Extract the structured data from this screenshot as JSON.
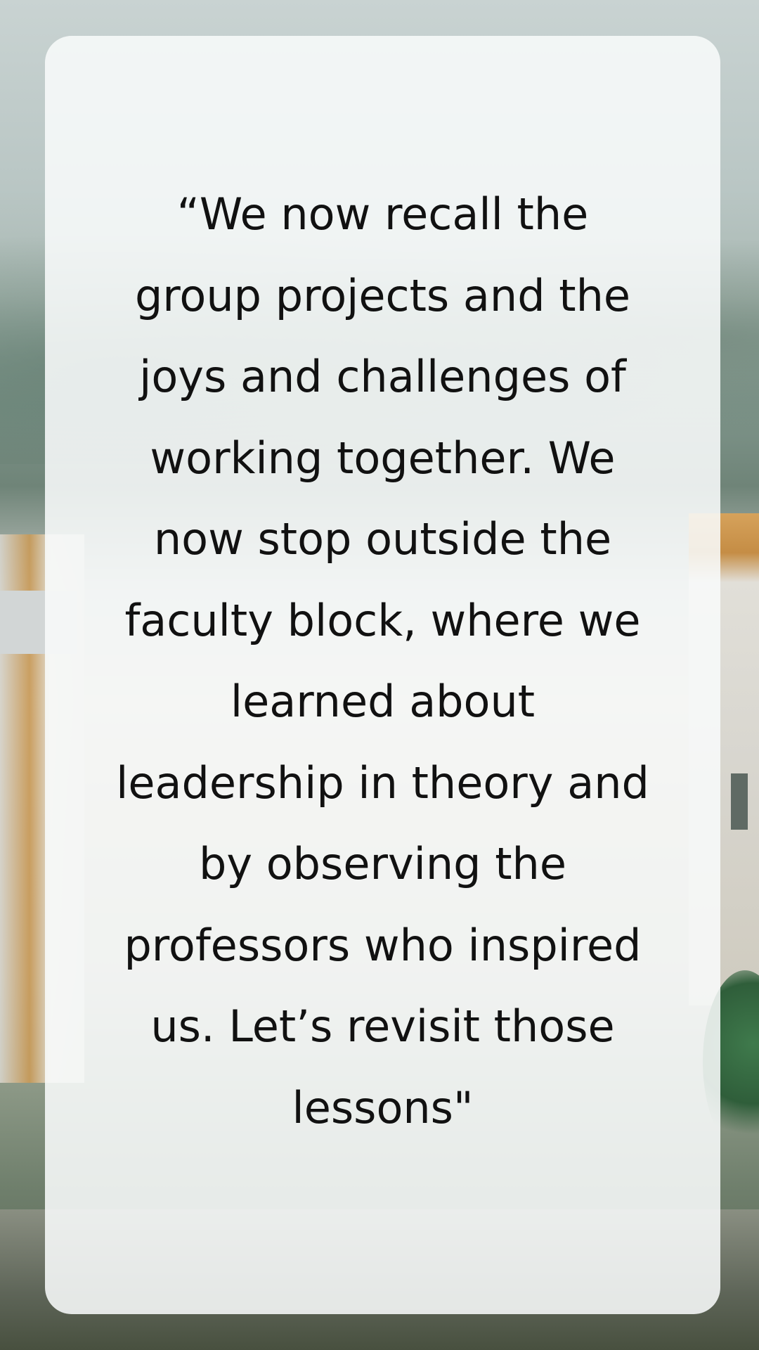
{
  "quote": {
    "lines": [
      "“We now recall the",
      "group projects and the",
      "joys and challenges of",
      "working together. We",
      "now stop outside the",
      "faculty block, where we",
      "learned about",
      "leadership in theory and",
      "by observing the",
      "professors who inspired",
      "us. Let’s revisit those",
      "lessons\""
    ]
  },
  "colors": {
    "card_background": "#f8fafa",
    "text": "#111111"
  }
}
